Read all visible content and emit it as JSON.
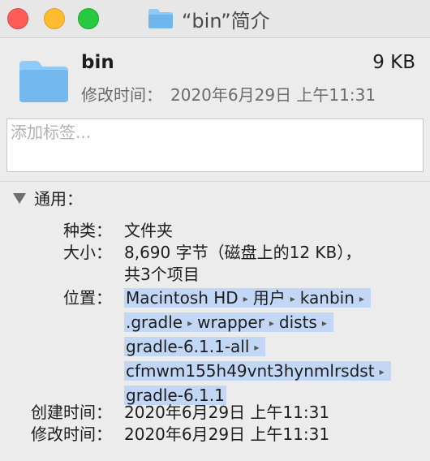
{
  "window": {
    "title": "“bin”简介"
  },
  "header": {
    "name": "bin",
    "size": "9 KB",
    "modified_label": "修改时间：",
    "modified_value": "2020年6月29日 上午11:31"
  },
  "tags": {
    "placeholder": "添加标签..."
  },
  "general": {
    "section_title": "通用：",
    "kind_label": "种类：",
    "kind_value": "文件夹",
    "size_label": "大小：",
    "size_value_line1": "8,690 字节（磁盘上的12 KB），",
    "size_value_line2": "共3个项目",
    "where_label": "位置：",
    "path": [
      "Macintosh HD",
      "用户",
      "kanbin",
      ".gradle",
      "wrapper",
      "dists",
      "gradle-6.1.1-all",
      "cfmwm155h49vnt3hynmlrsdst",
      "gradle-6.1.1"
    ],
    "path_separator": "▸",
    "created_label": "创建时间：",
    "created_value": "2020年6月29日 上午11:31",
    "modified_label": "修改时间：",
    "modified_value": "2020年6月29日 上午11:31"
  },
  "colors": {
    "path_highlight": "#c2d6f5",
    "folder_blue": "#7fbff5"
  }
}
